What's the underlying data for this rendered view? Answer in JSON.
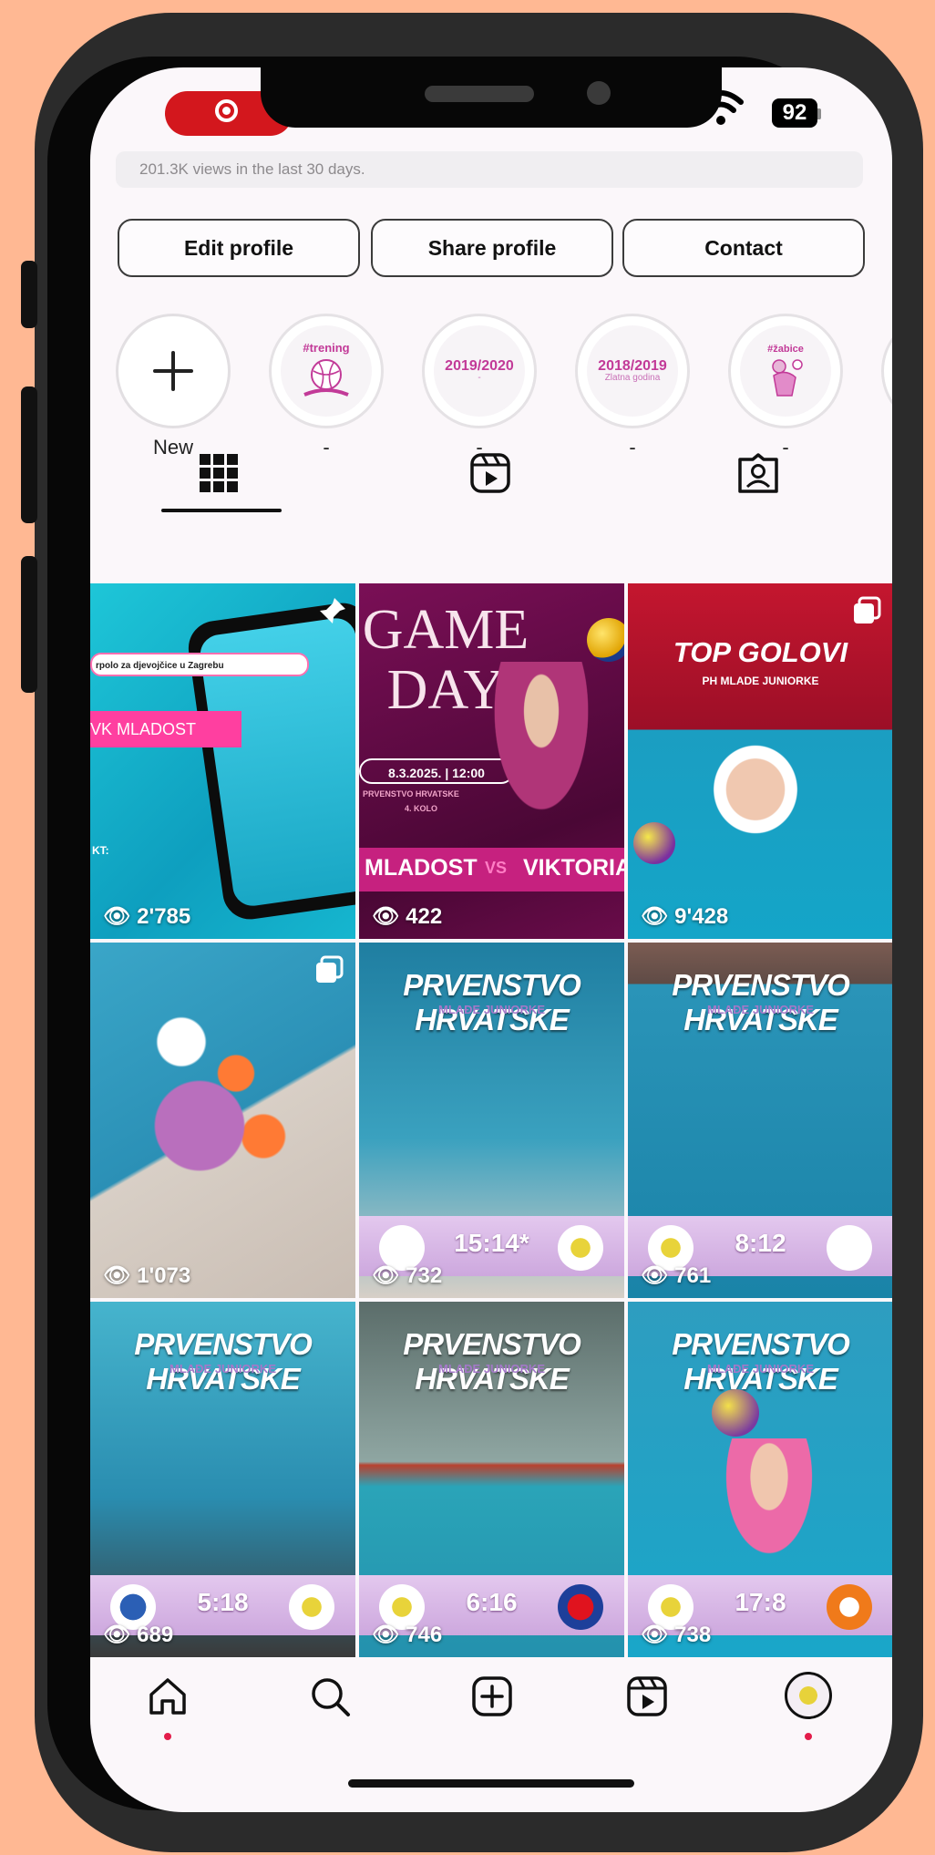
{
  "status": {
    "battery": "92"
  },
  "profile": {
    "views_text": "201.3K views in the last 30 days.",
    "buttons": {
      "edit": "Edit profile",
      "share": "Share profile",
      "contact": "Contact"
    }
  },
  "highlights": [
    {
      "label": "New"
    },
    {
      "title": "#trening",
      "sub": "",
      "label": "-"
    },
    {
      "title": "2019/2020",
      "sub": "-",
      "label": "-"
    },
    {
      "title": "2018/2019",
      "sub": "Zlatna godina",
      "label": "-"
    },
    {
      "title": "#žabice",
      "sub": "",
      "label": "-"
    }
  ],
  "tabs": [
    {
      "name": "grid",
      "icon": "grid-icon"
    },
    {
      "name": "reels",
      "icon": "reels-icon"
    },
    {
      "name": "tagged",
      "icon": "tagged-icon"
    }
  ],
  "posts": [
    {
      "views": "2'785",
      "title": "",
      "subtitle": "",
      "search_text": "rpolo za djevojčice u Zagrebu",
      "lines": [
        "VK MLADOST",
        "KT:"
      ]
    },
    {
      "views": "422",
      "title": "GAME DAY",
      "date_time": "8.3.2025. | 12:00",
      "competition": "PRVENSTVO HRVATSKE",
      "round": "4. KOLO",
      "home": "MLADOST",
      "vs": "VS",
      "away": "VIKTORIA"
    },
    {
      "views": "9'428",
      "title": "TOP GOLOVI",
      "subtitle": "PH MLADE JUNIORKE"
    },
    {
      "views": "1'073"
    },
    {
      "views": "732",
      "title": "PRVENSTVO HRVATSKE",
      "subtitle": "MLAĐE JUNIORKE",
      "score": "15:14*"
    },
    {
      "views": "761",
      "title": "PRVENSTVO HRVATSKE",
      "subtitle": "MLAĐE JUNIORKE",
      "score": "8:12"
    },
    {
      "views": "689",
      "title": "PRVENSTVO HRVATSKE",
      "subtitle": "MLAĐE JUNIORKE",
      "score": "5:18"
    },
    {
      "views": "746",
      "title": "PRVENSTVO HRVATSKE",
      "subtitle": "MLAĐE JUNIORKE",
      "score": "6:16"
    },
    {
      "views": "738",
      "title": "PRVENSTVO HRVATSKE",
      "subtitle": "MLAĐE JUNIORKE",
      "score": "17:8"
    }
  ],
  "nav": [
    {
      "name": "home",
      "icon": "home-icon"
    },
    {
      "name": "search",
      "icon": "search-icon"
    },
    {
      "name": "create",
      "icon": "plus-square-icon"
    },
    {
      "name": "reels",
      "icon": "reels-icon"
    },
    {
      "name": "profile",
      "icon": "profile-avatar-icon"
    }
  ],
  "colors": {
    "background": "#ffb893",
    "recording": "#d3171d",
    "accent": "#c23a98",
    "nav_dot": "#e31c4a"
  }
}
